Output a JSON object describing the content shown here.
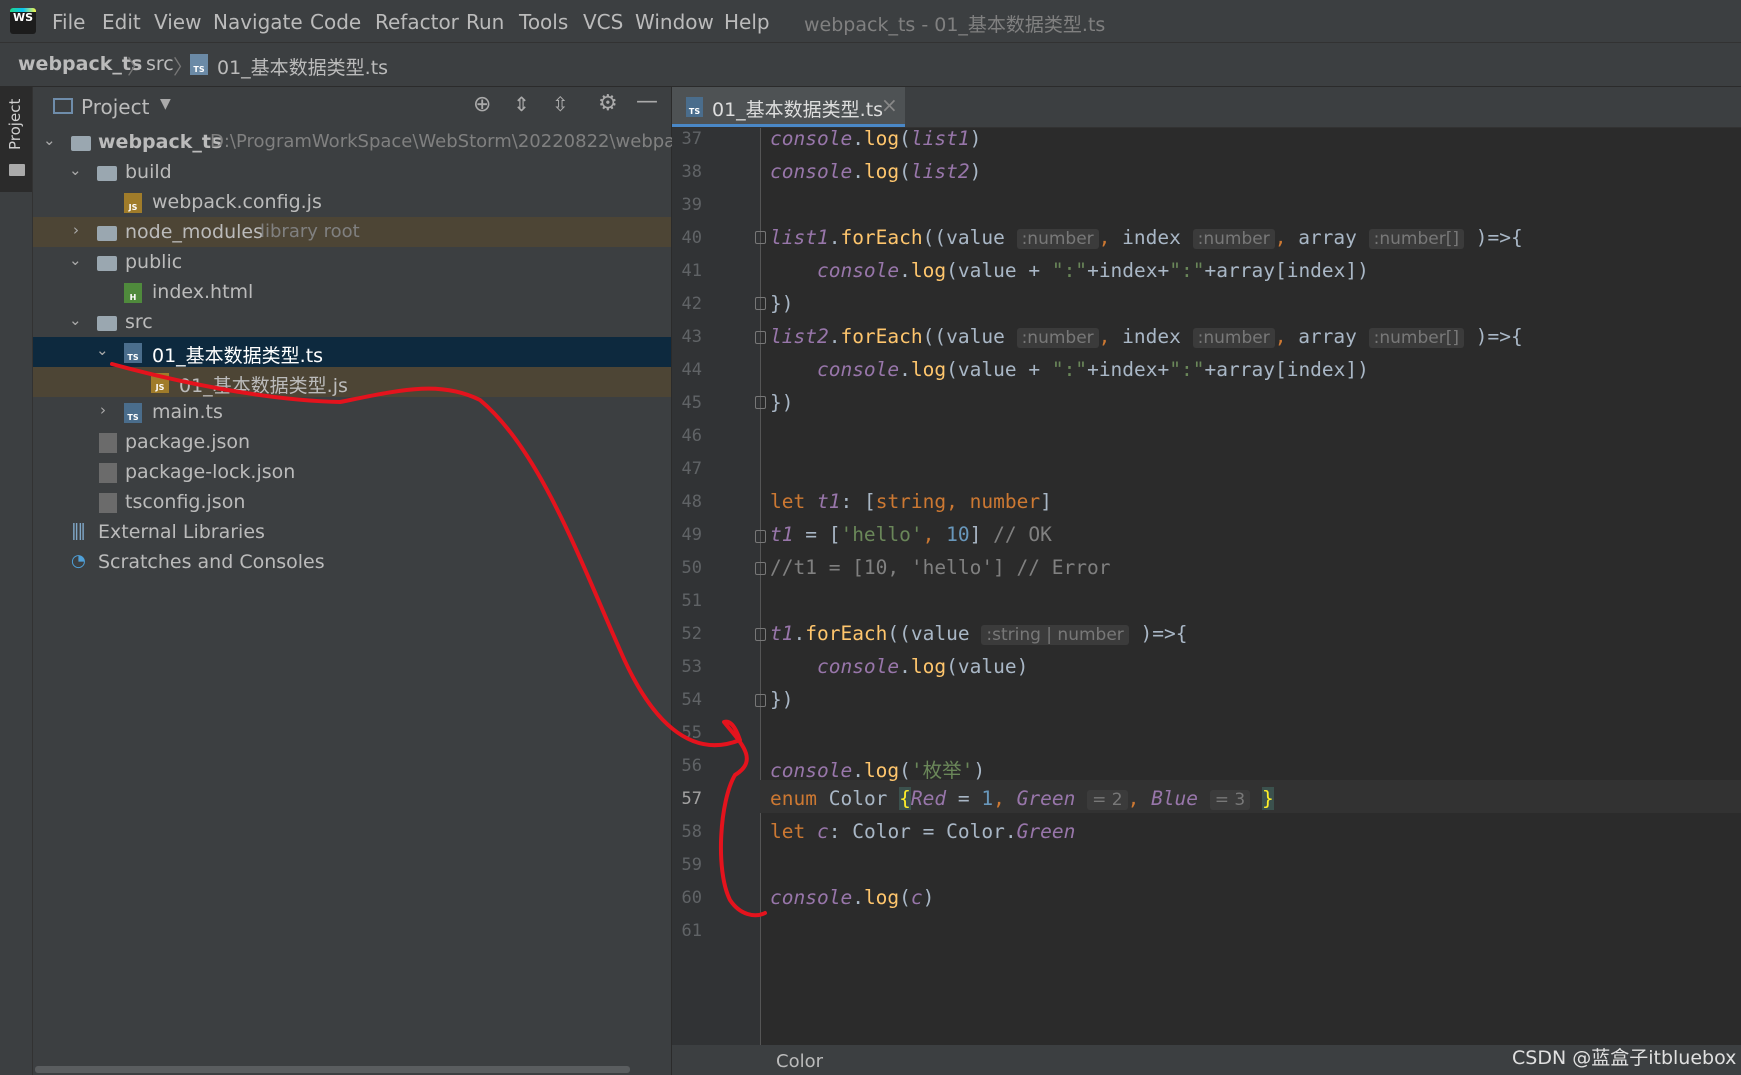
{
  "menu": {
    "items": [
      "File",
      "Edit",
      "View",
      "Navigate",
      "Code",
      "Refactor",
      "Run",
      "Tools",
      "VCS",
      "Window",
      "Help"
    ],
    "window_title": "webpack_ts - 01_基本数据类型.ts"
  },
  "breadcrumb": {
    "project": "webpack_ts",
    "folder": "src",
    "file": "01_基本数据类型.ts"
  },
  "toolstrip": {
    "project_label": "Project"
  },
  "project_panel": {
    "title": "Project",
    "root_name": "webpack_ts",
    "root_path": "D:\\ProgramWorkSpace\\WebStorm\\20220822\\webpac",
    "build": "build",
    "webpack_config": "webpack.config.js",
    "node_modules": "node_modules",
    "library_root": "library root",
    "public": "public",
    "index_html": "index.html",
    "src": "src",
    "ts_file": "01_基本数据类型.ts",
    "js_file": "01_基本数据类型.js",
    "main_ts": "main.ts",
    "package_json": "package.json",
    "package_lock": "package-lock.json",
    "tsconfig": "tsconfig.json",
    "external_libraries": "External Libraries",
    "scratches": "Scratches and Consoles",
    "file_badges": {
      "js": "JS",
      "ts": "TS",
      "html": "H"
    }
  },
  "editor": {
    "tab_label": "01_基本数据类型.ts",
    "tab_close": "×",
    "current_line": "57",
    "line_numbers": [
      "37",
      "38",
      "39",
      "40",
      "41",
      "42",
      "43",
      "44",
      "45",
      "46",
      "47",
      "48",
      "49",
      "50",
      "51",
      "52",
      "53",
      "54",
      "55",
      "56",
      "57",
      "58",
      "59",
      "60",
      "61"
    ],
    "tokens": {
      "console": "console",
      "log": "log",
      "list1": "list1",
      "list2": "list2",
      "forEach": "forEach",
      "value": "value",
      "index": "index",
      "array": "array",
      "hint_number": ":number",
      "hint_number_arr": ":number[]",
      "hint_str_num": ":string | number",
      "let": "let",
      "t1": "t1",
      "string": "string",
      "number": "number",
      "hello": "'hello'",
      "ten": "10",
      "ok_comment": "// OK",
      "err_comment": "//t1 = [10, 'hello'] // Error",
      "enum_str": "'枚举'",
      "enum": "enum",
      "Color": "Color",
      "Red": "Red",
      "one": "1",
      "Green": "Green",
      "hint_eq2": "= 2",
      "Blue": "Blue",
      "hint_eq3": "= 3",
      "c": "c",
      "colon_str": "\":\""
    }
  },
  "status": {
    "context": "Color"
  },
  "watermark": "CSDN @蓝盒子itbluebox",
  "colors": {
    "keyword": "#cc7832",
    "string": "#6a8759",
    "number": "#6897bb",
    "ident": "#9876aa",
    "annotation": "#ff0000"
  }
}
